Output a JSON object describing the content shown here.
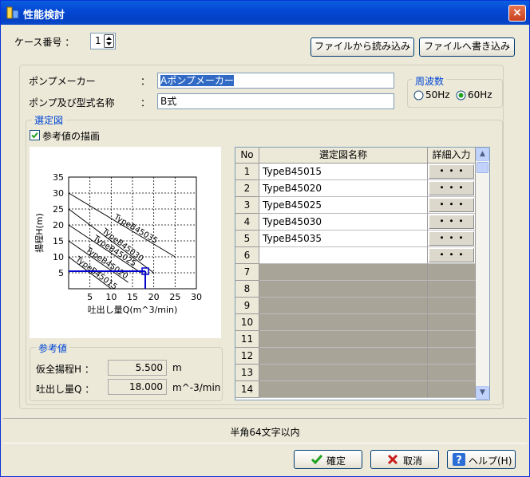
{
  "window": {
    "title": "性能検討",
    "close_label": "×"
  },
  "case": {
    "label": "ケース番号 ：",
    "value": "1"
  },
  "file": {
    "read_label": "ファイルから読み込み",
    "write_label": "ファイルへ書き込み"
  },
  "pump": {
    "maker_label": "ポンプメーカー",
    "maker_value": "Aポンプメーカー",
    "model_label": "ポンプ及び型式名称",
    "model_value": "B式",
    "colon": "："
  },
  "frequency": {
    "title": "周波数",
    "opt50": "50Hz",
    "opt60": "60Hz",
    "selected": "60Hz"
  },
  "selection": {
    "title": "選定図",
    "checkbox_label": "参考値の描画",
    "checked": true
  },
  "chart_data": {
    "type": "line",
    "xlabel": "吐出し量Q(m^3/min)",
    "ylabel": "揚程H(m)",
    "xlim": [
      0,
      30
    ],
    "ylim": [
      0,
      35
    ],
    "xticks": [
      "5",
      "10",
      "15",
      "20",
      "25",
      "30"
    ],
    "yticks": [
      "5",
      "10",
      "15",
      "20",
      "25",
      "30",
      "35"
    ],
    "series": [
      {
        "name": "TypeB45035",
        "points": [
          [
            0,
            30
          ],
          [
            25,
            10
          ]
        ]
      },
      {
        "name": "TypeB45030",
        "points": [
          [
            0,
            25
          ],
          [
            20,
            5
          ]
        ]
      },
      {
        "name": "TypeB45025",
        "points": [
          [
            0,
            20
          ],
          [
            17,
            5
          ]
        ]
      },
      {
        "name": "TypeB45020",
        "points": [
          [
            0,
            15
          ],
          [
            14,
            2
          ]
        ]
      },
      {
        "name": "TypeB45015",
        "points": [
          [
            0,
            10
          ],
          [
            10,
            0
          ]
        ]
      }
    ],
    "reference_point": {
      "x": 18.0,
      "y": 5.5
    },
    "grid": true
  },
  "reference": {
    "title": "参考値",
    "head_label": "仮全揚程H ：",
    "head_value": "5.500",
    "head_unit": "m",
    "flow_label": "吐出し量Q ：",
    "flow_value": "18.000",
    "flow_unit": "m^-3/min"
  },
  "table": {
    "col_no": "No",
    "col_name": "選定図名称",
    "col_detail": "詳細入力",
    "detail_btn": "・・・",
    "rows": [
      {
        "no": "1",
        "name": "TypeB45015"
      },
      {
        "no": "2",
        "name": "TypeB45020"
      },
      {
        "no": "3",
        "name": "TypeB45025"
      },
      {
        "no": "4",
        "name": "TypeB45030"
      },
      {
        "no": "5",
        "name": "TypeB45035"
      },
      {
        "no": "6",
        "name": ""
      },
      {
        "no": "7",
        "name": ""
      },
      {
        "no": "8",
        "name": ""
      },
      {
        "no": "9",
        "name": ""
      },
      {
        "no": "10",
        "name": ""
      },
      {
        "no": "11",
        "name": ""
      },
      {
        "no": "12",
        "name": ""
      },
      {
        "no": "13",
        "name": ""
      },
      {
        "no": "14",
        "name": ""
      }
    ]
  },
  "status": {
    "text": "半角64文字以内"
  },
  "buttons": {
    "ok": "確定",
    "cancel": "取消",
    "help": "ヘルプ(H)"
  },
  "colors": {
    "accent": "#0046D5",
    "titlebar": "#0448D4",
    "chart_blue": "#0000CC"
  }
}
